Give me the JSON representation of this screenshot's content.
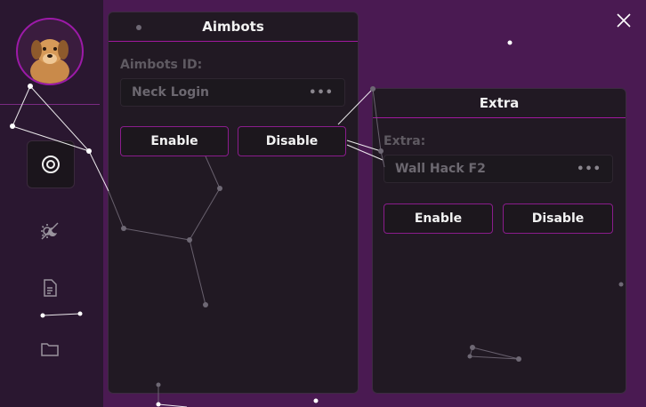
{
  "sidebar": {
    "items": [
      {
        "icon": "target-icon",
        "active": true
      },
      {
        "icon": "theme-icon",
        "active": false
      },
      {
        "icon": "document-icon",
        "active": false
      },
      {
        "icon": "folder-icon",
        "active": false
      }
    ]
  },
  "aimbots_panel": {
    "title": "Aimbots",
    "field_label": "Aimbots ID:",
    "field_value": "Neck Login",
    "enable_label": "Enable",
    "disable_label": "Disable"
  },
  "extra_panel": {
    "title": "Extra",
    "field_label": "Extra:",
    "field_value": "Wall Hack F2",
    "enable_label": "Enable",
    "disable_label": "Disable"
  },
  "colors": {
    "background": "#4a1a52",
    "sidebar": "#2a1730",
    "panel": "#211923",
    "accent": "#a0189e"
  }
}
